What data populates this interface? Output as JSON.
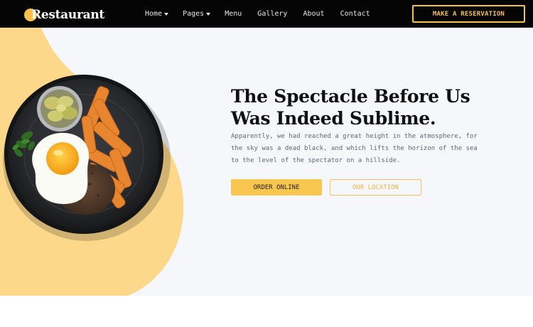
{
  "brand": {
    "name": "Restaurant"
  },
  "nav": {
    "items": [
      {
        "label": "Home",
        "has_dropdown": true
      },
      {
        "label": "Pages",
        "has_dropdown": true
      },
      {
        "label": "Menu",
        "has_dropdown": false
      },
      {
        "label": "Gallery",
        "has_dropdown": false
      },
      {
        "label": "About",
        "has_dropdown": false
      },
      {
        "label": "Contact",
        "has_dropdown": false
      }
    ],
    "cta_label": "MAKE A RESERVATION"
  },
  "hero": {
    "title_light_1": "The Spectacle ",
    "title_bold_1": "Before Us",
    "title_bold_2": "Was Indeed",
    "title_light_2": " Sublime.",
    "description": "Apparently, we had reached a great height in the atmosphere, for the sky was a dead black, and which lifts the horizon of the sea to the level of the spectator on a hillside.",
    "primary_button": "ORDER ONLINE",
    "secondary_button": "OUR LOCATION",
    "image_icon": "plate-of-food-icon"
  },
  "colors": {
    "accent": "#f9c74f",
    "nav_background": "#050505",
    "hero_background": "#f6f7fb",
    "blob": "#fdd88a"
  }
}
